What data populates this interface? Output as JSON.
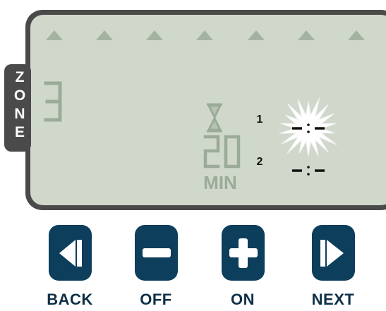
{
  "zone": {
    "label_letters": [
      "Z",
      "O",
      "N",
      "E"
    ],
    "number": "3"
  },
  "duration": {
    "value": "20",
    "unit": "MIN"
  },
  "program_rows": [
    {
      "label": "1",
      "value": "--:--",
      "active": true
    },
    {
      "label": "2",
      "value": "--:--",
      "active": false
    }
  ],
  "indicator_triangles": 7,
  "buttons": [
    {
      "id": "back",
      "label": "BACK",
      "icon": "back-icon"
    },
    {
      "id": "off",
      "label": "OFF",
      "icon": "minus-icon"
    },
    {
      "id": "on",
      "label": "ON",
      "icon": "plus-icon"
    },
    {
      "id": "next",
      "label": "NEXT",
      "icon": "next-icon"
    }
  ],
  "colors": {
    "panel_border": "#4a4a4a",
    "lcd": "#cfd8cb",
    "segment": "#9aab98",
    "button": "#0d3e5c",
    "ink": "#111111"
  }
}
